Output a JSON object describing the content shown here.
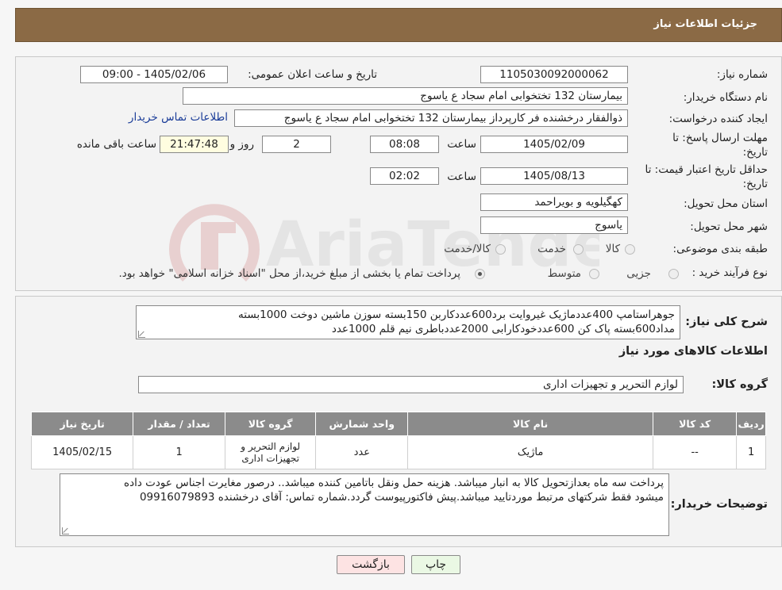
{
  "header": {
    "title": "جزئیات اطلاعات نیاز"
  },
  "need_number": {
    "label": "شماره نیاز:",
    "value": "1105030092000062"
  },
  "announce": {
    "label": "تاریخ و ساعت اعلان عمومی:",
    "value": "1405/02/06 - 09:00"
  },
  "buyer_org": {
    "label": "نام دستگاه خریدار:",
    "value": "بیمارستان 132 تختخوابی امام سجاد  ع  یاسوج"
  },
  "requester": {
    "label": "ایجاد کننده درخواست:",
    "value": "ذوالفقار درخشنده فر کارپرداز بیمارستان 132 تختخوابی امام سجاد  ع  یاسوج",
    "contact_link": "اطلاعات تماس خریدار"
  },
  "deadline": {
    "label_line1": "مهلت ارسال پاسخ: تا",
    "label_line2": "تاریخ:",
    "date": "1405/02/09",
    "time_label": "ساعت",
    "time": "08:08",
    "days": "2",
    "days_label": "روز و",
    "remaining": "21:47:48",
    "remaining_label": "ساعت باقی مانده"
  },
  "validity": {
    "label_line1": "حداقل تاریخ اعتبار قیمت: تا",
    "label_line2": "تاریخ:",
    "date": "1405/08/13",
    "time_label": "ساعت",
    "time": "02:02"
  },
  "province": {
    "label": "استان محل تحویل:",
    "value": "کهگیلویه و بویراحمد"
  },
  "city": {
    "label": "شهر محل تحویل:",
    "value": "یاسوج"
  },
  "category": {
    "label": "طبقه بندی موضوعی:",
    "options": [
      "کالا",
      "خدمت",
      "کالا/خدمت"
    ]
  },
  "process": {
    "label": "نوع فرآیند خرید :",
    "options": [
      "جزیی",
      "متوسط"
    ],
    "note": "پرداخت تمام یا بخشی از مبلغ خرید،از محل \"اسناد خزانه اسلامی\" خواهد بود."
  },
  "description": {
    "label": "شرح کلی نیاز:",
    "line1": "جوهراستامپ 400عددماژیک غیروایت برد600عددکاربن 150بسته سوزن ماشین دوخت 1000بسته",
    "line2": "مداد600بسته پاک کن 600عددخودکارابی 2000عددباطری نیم قلم 1000عدد"
  },
  "goods_info": {
    "title": "اطلاعات کالاهای مورد نیاز"
  },
  "goods_group": {
    "label": "گروه کالا:",
    "value": "لوازم التحریر و تجهیزات اداری"
  },
  "table": {
    "headers": [
      "ردیف",
      "کد کالا",
      "نام کالا",
      "واحد شمارش",
      "گروه کالا",
      "تعداد / مقدار",
      "تاریخ نیاز"
    ],
    "rows": [
      [
        "1",
        "--",
        "ماژیک",
        "عدد",
        "لوازم التحریر و تجهیزات اداری",
        "1",
        "1405/02/15"
      ]
    ]
  },
  "buyer_notes": {
    "label": "توضیحات خریدار:",
    "line1": "پرداخت سه ماه بعدازتحویل کالا به انبار میباشد. هزینه حمل ونقل باتامین کننده میباشد.. درصور مغایرت اجناس عودت داده",
    "line2": "میشود فقط شرکتهای مرتبط موردتایید میباشد.پیش فاکتورپیوست گردد.شماره تماس: آقای درخشنده 09916079893"
  },
  "buttons": {
    "print": "چاپ",
    "back": "بازگشت"
  },
  "watermark": {
    "text": "AriaTender.neT"
  }
}
